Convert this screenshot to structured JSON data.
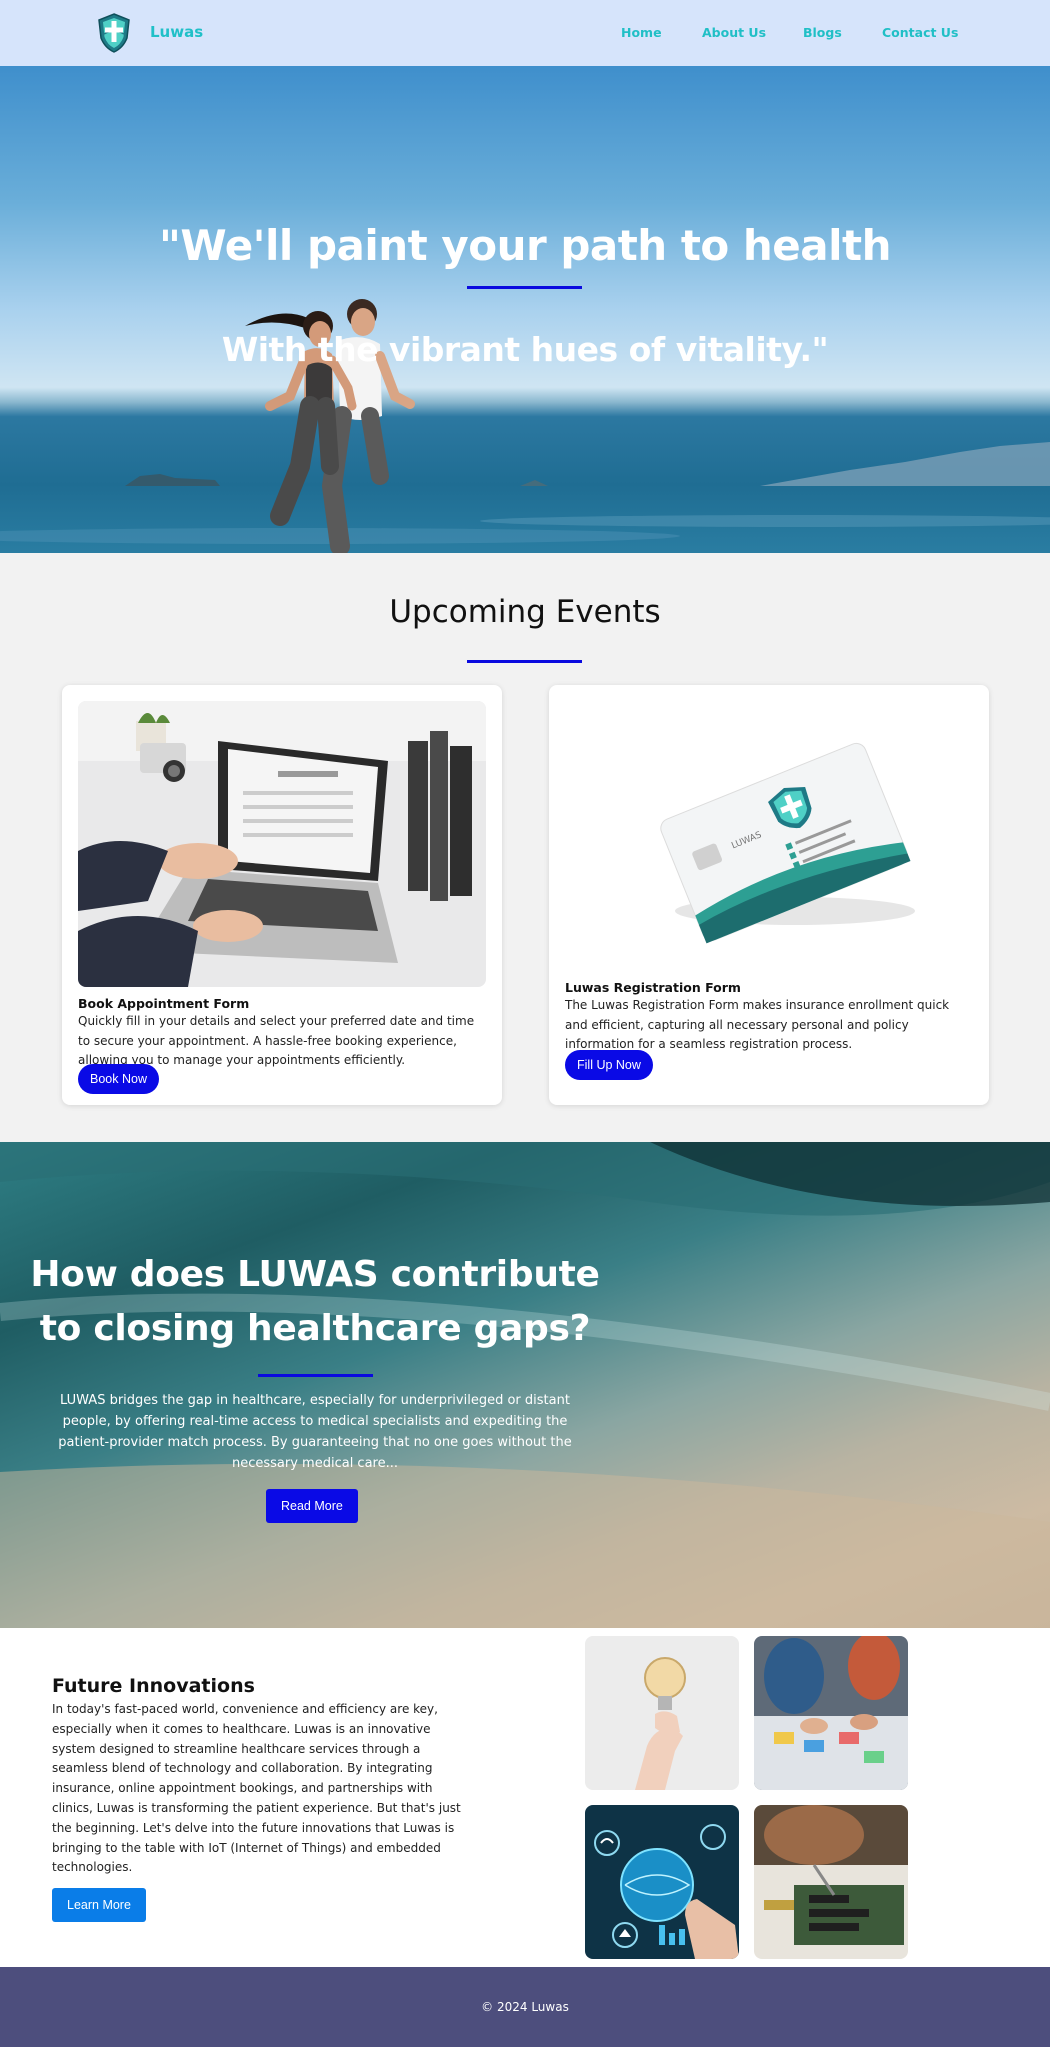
{
  "nav": {
    "brand": "Luwas",
    "links": [
      "Home",
      "About Us",
      "Blogs",
      "Contact Us"
    ]
  },
  "hero": {
    "headline": "\"We'll paint your path to health",
    "subheadline": "With the vibrant hues of vitality.\""
  },
  "events": {
    "title": "Upcoming Events",
    "cards": [
      {
        "title": "Book Appointment Form",
        "text": "Quickly fill in your details and select your preferred date and time to secure your appointment. A hassle-free booking experience, allowing you to manage your appointments efficiently.",
        "button": "Book Now"
      },
      {
        "title": "Luwas Registration Form",
        "text": "The Luwas Registration Form makes insurance enrollment quick and efficient, capturing all necessary personal and policy information for a seamless registration process.",
        "button": "Fill Up Now",
        "card_brand": "LUWAS"
      }
    ]
  },
  "gaps": {
    "title": "How does LUWAS contribute to closing healthcare gaps?",
    "text": "LUWAS bridges the gap in healthcare, especially for underprivileged or distant people, by offering real-time access to medical specialists and expediting the patient-provider match process. By guaranteeing that no one goes without the necessary medical care...",
    "button": "Read More"
  },
  "innovations": {
    "title": "Future Innovations",
    "text": "In today's fast-paced world, convenience and efficiency are key, especially when it comes to healthcare. Luwas is an innovative system designed to streamline healthcare services through a seamless blend of technology and collaboration. By integrating insurance, online appointment bookings, and partnerships with clinics, Luwas is transforming the patient experience. But that's just the beginning. Let's delve into the future innovations that Luwas is bringing to the table with IoT (Internet of Things) and embedded technologies.",
    "button": "Learn More"
  },
  "footer": {
    "text": "© 2024 Luwas"
  },
  "colors": {
    "nav_bg": "#d6e4fb",
    "brand_teal": "#20c0c8",
    "accent_blue": "#0a0ae6",
    "learn_blue": "#0a7de8",
    "footer_bg": "#4d4e7d"
  },
  "icons": [
    "shield-cross-logo"
  ]
}
